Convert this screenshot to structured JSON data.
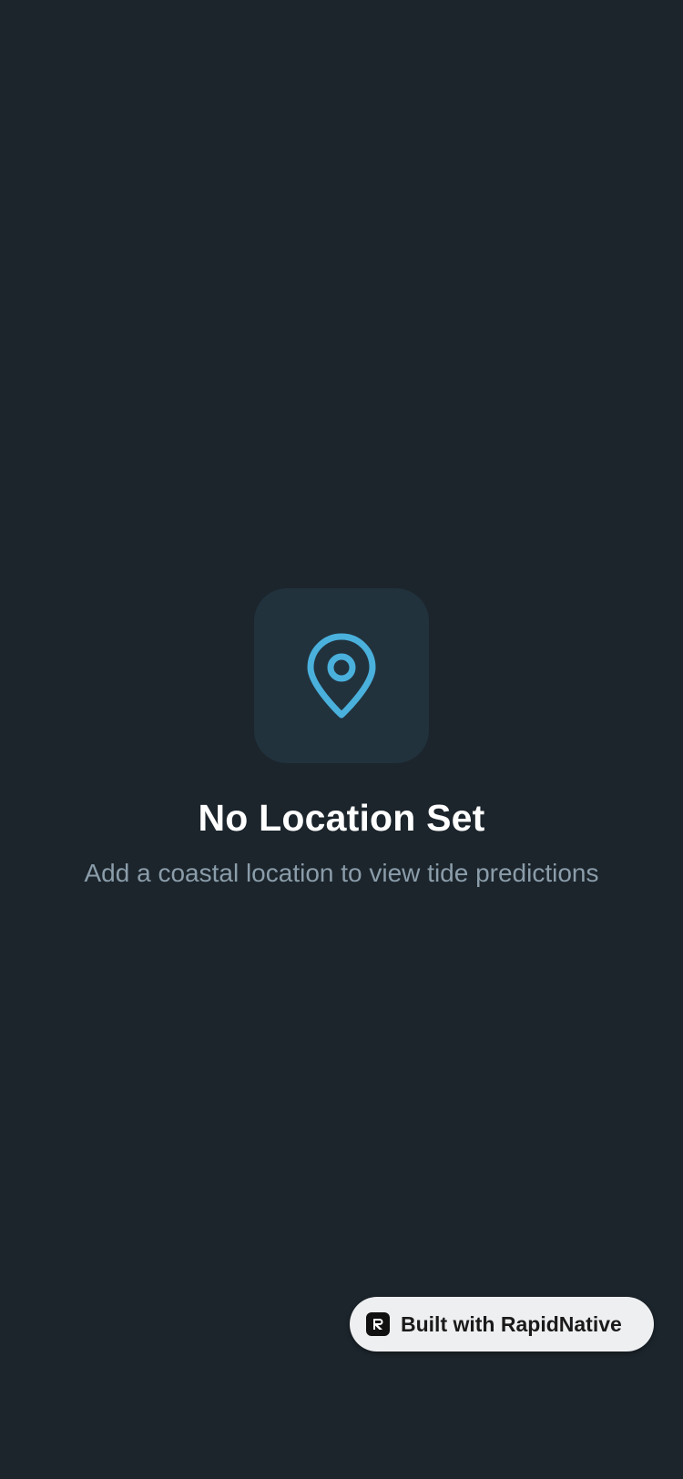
{
  "empty_state": {
    "icon": "map-pin-icon",
    "title": "No Location Set",
    "subtitle": "Add a coastal location to view tide predictions"
  },
  "badge": {
    "label": "Built with RapidNative",
    "logo_icon": "rapidnative-logo-icon"
  },
  "colors": {
    "background": "#1c252c",
    "icon_tile": "#21323d",
    "accent": "#4ab0dc",
    "title": "#ffffff",
    "subtitle": "#8b9daa",
    "badge_background": "#eeeff1"
  }
}
